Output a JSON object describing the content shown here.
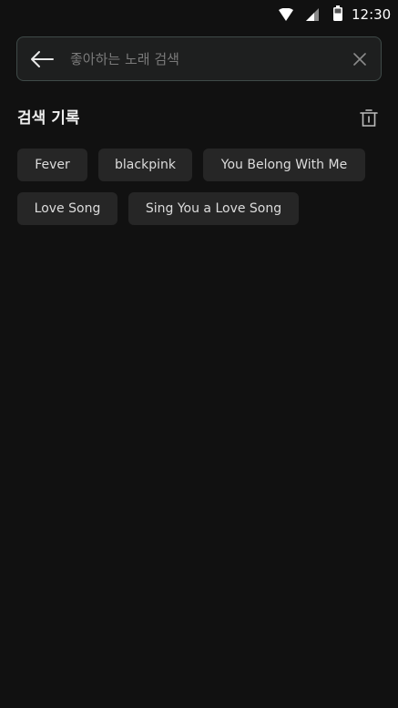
{
  "status_bar": {
    "time": "12:30",
    "icons": [
      "wifi-icon",
      "signal-icon",
      "battery-icon"
    ]
  },
  "search": {
    "placeholder": "좋아하는 노래 검색",
    "value": "",
    "icons": [
      "back-arrow-icon",
      "clear-icon"
    ]
  },
  "history": {
    "title": "검색 기록",
    "icon": "trash-icon",
    "items": [
      {
        "label": "Fever"
      },
      {
        "label": "blackpink"
      },
      {
        "label": "You Belong With Me"
      },
      {
        "label": "Love Song"
      },
      {
        "label": "Sing You a Love Song"
      }
    ]
  },
  "colors": {
    "background": "#111111",
    "chip": "#262626",
    "search_border": "#3f4a48"
  }
}
